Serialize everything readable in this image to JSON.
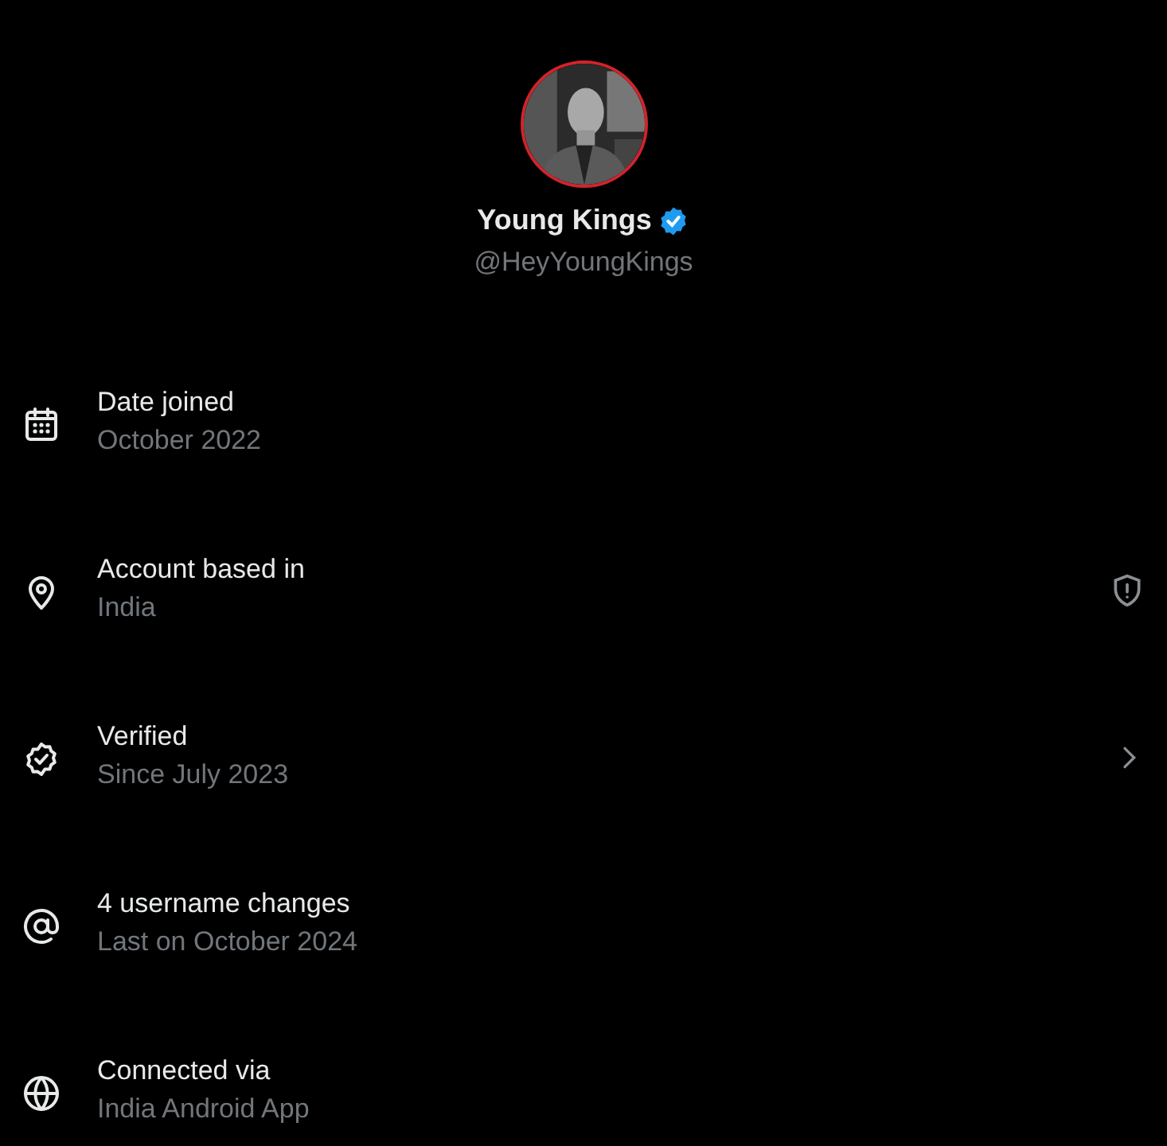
{
  "profile": {
    "name": "Young Kings",
    "handle": "@HeyYoungKings",
    "verified": true
  },
  "rows": [
    {
      "title": "Date joined",
      "subtitle": "October 2022"
    },
    {
      "title": "Account based in",
      "subtitle": "India"
    },
    {
      "title": "Verified",
      "subtitle": "Since July 2023"
    },
    {
      "title": "4 username changes",
      "subtitle": "Last on October 2024"
    },
    {
      "title": "Connected via",
      "subtitle": "India Android App"
    }
  ]
}
